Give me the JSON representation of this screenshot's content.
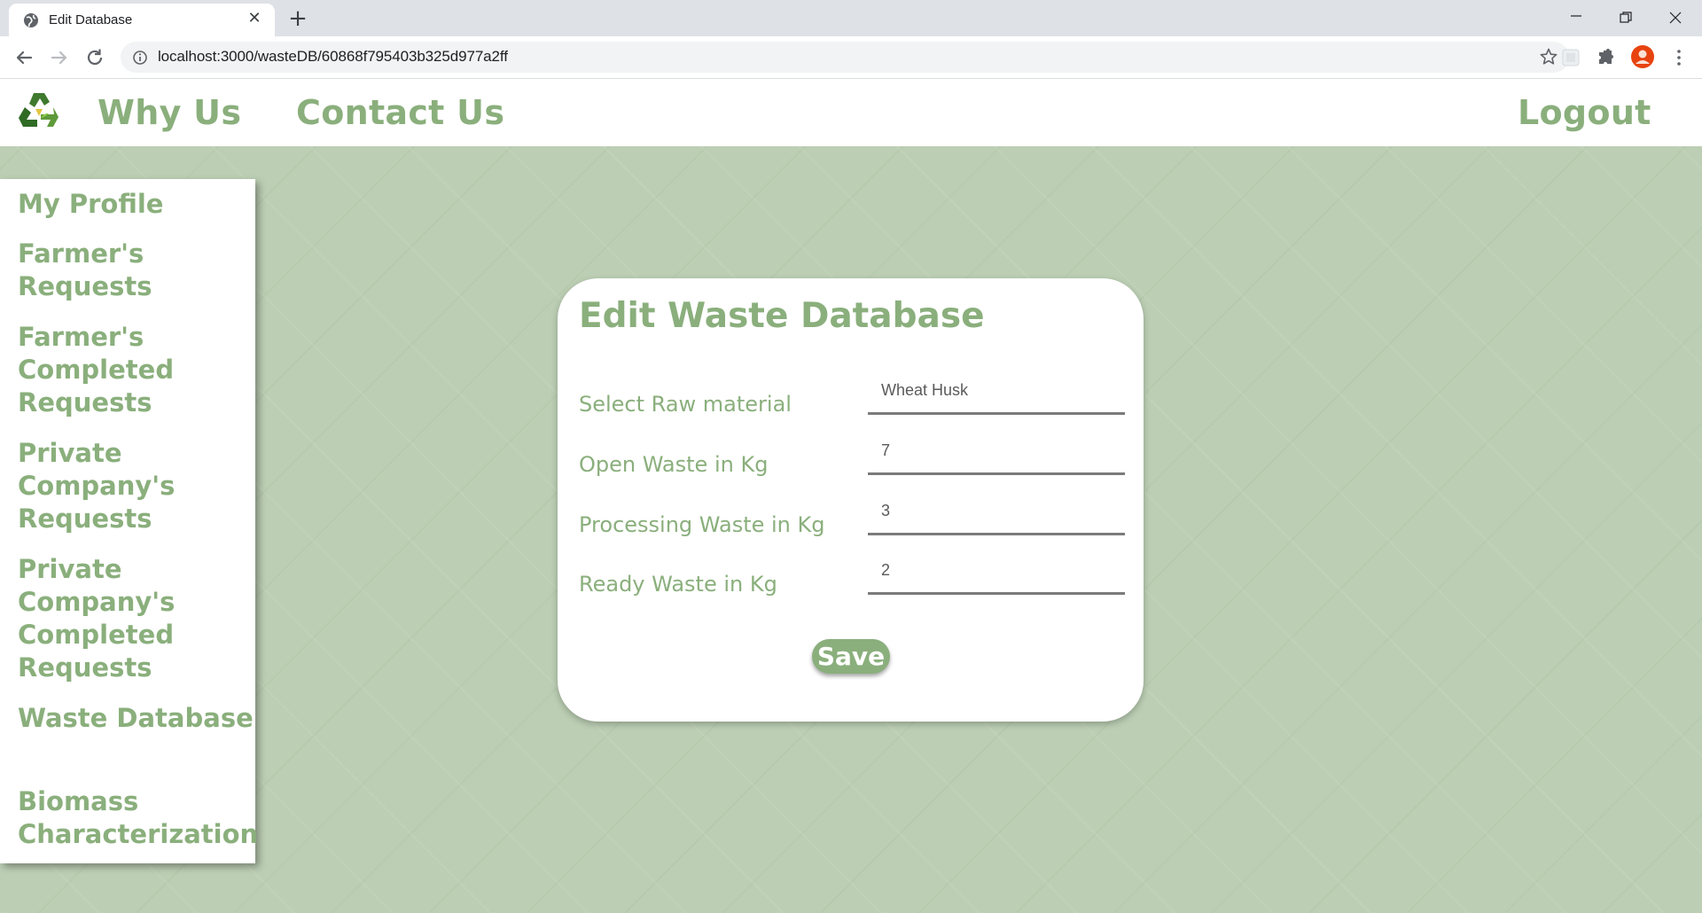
{
  "browser": {
    "tab_title": "Edit Database",
    "url": "localhost:3000/wasteDB/60868f795403b325d977a2ff"
  },
  "header": {
    "why_us": "Why Us",
    "contact_us": "Contact Us",
    "logout": "Logout"
  },
  "sidebar": {
    "items": [
      {
        "label": "My Profile"
      },
      {
        "label": "Farmer's Requests"
      },
      {
        "label": "Farmer's Completed Requests"
      },
      {
        "label": "Private Company's Requests"
      },
      {
        "label": "Private Company's Completed Requests"
      },
      {
        "label": "Waste Database"
      },
      {
        "label": "Biomass Characterization"
      }
    ]
  },
  "form": {
    "title": "Edit Waste Database",
    "fields": [
      {
        "label": "Select Raw material",
        "value": "Wheat Husk"
      },
      {
        "label": "Open Waste in Kg",
        "value": "7"
      },
      {
        "label": "Processing Waste in Kg",
        "value": "3"
      },
      {
        "label": "Ready Waste in Kg",
        "value": "2"
      }
    ],
    "save_label": "Save"
  },
  "colors": {
    "accent": "#8aaf7c",
    "background": "#bccfb4"
  }
}
